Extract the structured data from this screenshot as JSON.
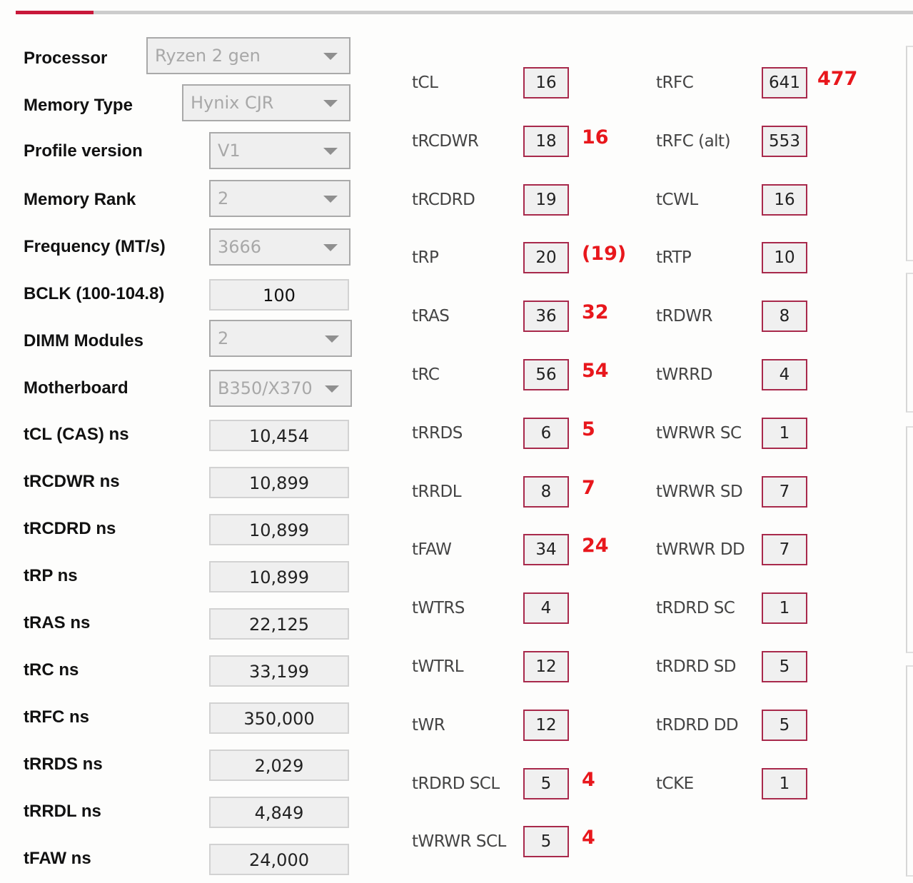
{
  "header": {
    "tab_indicator": {
      "active_color": "#c8183a",
      "track_color": "#cccccc"
    }
  },
  "settings": [
    {
      "label": "Processor",
      "kind": "dropdown",
      "value": "Ryzen 2 gen"
    },
    {
      "label": "Memory Type",
      "kind": "dropdown",
      "value": "Hynix CJR"
    },
    {
      "label": "Profile version",
      "kind": "dropdown",
      "value": "V1"
    },
    {
      "label": "Memory Rank",
      "kind": "dropdown",
      "value": "2"
    },
    {
      "label": "Frequency (MT/s)",
      "kind": "dropdown",
      "value": "3666"
    },
    {
      "label": "BCLK (100-104.8)",
      "kind": "input",
      "value": "100"
    },
    {
      "label": "DIMM Modules",
      "kind": "dropdown",
      "value": "2"
    },
    {
      "label": "Motherboard",
      "kind": "dropdown",
      "value": "B350/X370"
    }
  ],
  "ns_values": [
    {
      "label": "tCL (CAS) ns",
      "value": "10,454"
    },
    {
      "label": "tRCDWR ns",
      "value": "10,899"
    },
    {
      "label": "tRCDRD ns",
      "value": "10,899"
    },
    {
      "label": "tRP ns",
      "value": "10,899"
    },
    {
      "label": "tRAS ns",
      "value": "22,125"
    },
    {
      "label": "tRC ns",
      "value": "33,199"
    },
    {
      "label": "tRFC ns",
      "value": "350,000"
    },
    {
      "label": "tRRDS ns",
      "value": "2,029"
    },
    {
      "label": "tRRDL ns",
      "value": "4,849"
    },
    {
      "label": "tFAW ns",
      "value": "24,000"
    }
  ],
  "timings_primary": [
    {
      "label": "tCL",
      "value": "16",
      "note": ""
    },
    {
      "label": "tRCDWR",
      "value": "18",
      "note": "16"
    },
    {
      "label": "tRCDRD",
      "value": "19",
      "note": ""
    },
    {
      "label": "tRP",
      "value": "20",
      "note": "(19)"
    },
    {
      "label": "tRAS",
      "value": "36",
      "note": "32"
    },
    {
      "label": "tRC",
      "value": "56",
      "note": "54"
    },
    {
      "label": "tRRDS",
      "value": "6",
      "note": "5"
    },
    {
      "label": "tRRDL",
      "value": "8",
      "note": "7"
    },
    {
      "label": "tFAW",
      "value": "34",
      "note": "24"
    },
    {
      "label": "tWTRS",
      "value": "4",
      "note": ""
    },
    {
      "label": "tWTRL",
      "value": "12",
      "note": ""
    },
    {
      "label": "tWR",
      "value": "12",
      "note": ""
    },
    {
      "label": "tRDRD SCL",
      "value": "5",
      "note": "4"
    },
    {
      "label": "tWRWR SCL",
      "value": "5",
      "note": "4"
    }
  ],
  "timings_secondary": [
    {
      "label": "tRFC",
      "value": "641",
      "note": "477"
    },
    {
      "label": "tRFC (alt)",
      "value": "553",
      "note": ""
    },
    {
      "label": "tCWL",
      "value": "16",
      "note": ""
    },
    {
      "label": "tRTP",
      "value": "10",
      "note": ""
    },
    {
      "label": "tRDWR",
      "value": "8",
      "note": ""
    },
    {
      "label": "tWRRD",
      "value": "4",
      "note": ""
    },
    {
      "label": "tWRWR SC",
      "value": "1",
      "note": ""
    },
    {
      "label": "tWRWR SD",
      "value": "7",
      "note": ""
    },
    {
      "label": "tWRWR DD",
      "value": "7",
      "note": ""
    },
    {
      "label": "tRDRD SC",
      "value": "1",
      "note": ""
    },
    {
      "label": "tRDRD SD",
      "value": "5",
      "note": ""
    },
    {
      "label": "tRDRD DD",
      "value": "5",
      "note": ""
    },
    {
      "label": "tCKE",
      "value": "1",
      "note": ""
    }
  ],
  "colors": {
    "timing_box_border": "#a8294b",
    "annotation": "#e8171c"
  }
}
